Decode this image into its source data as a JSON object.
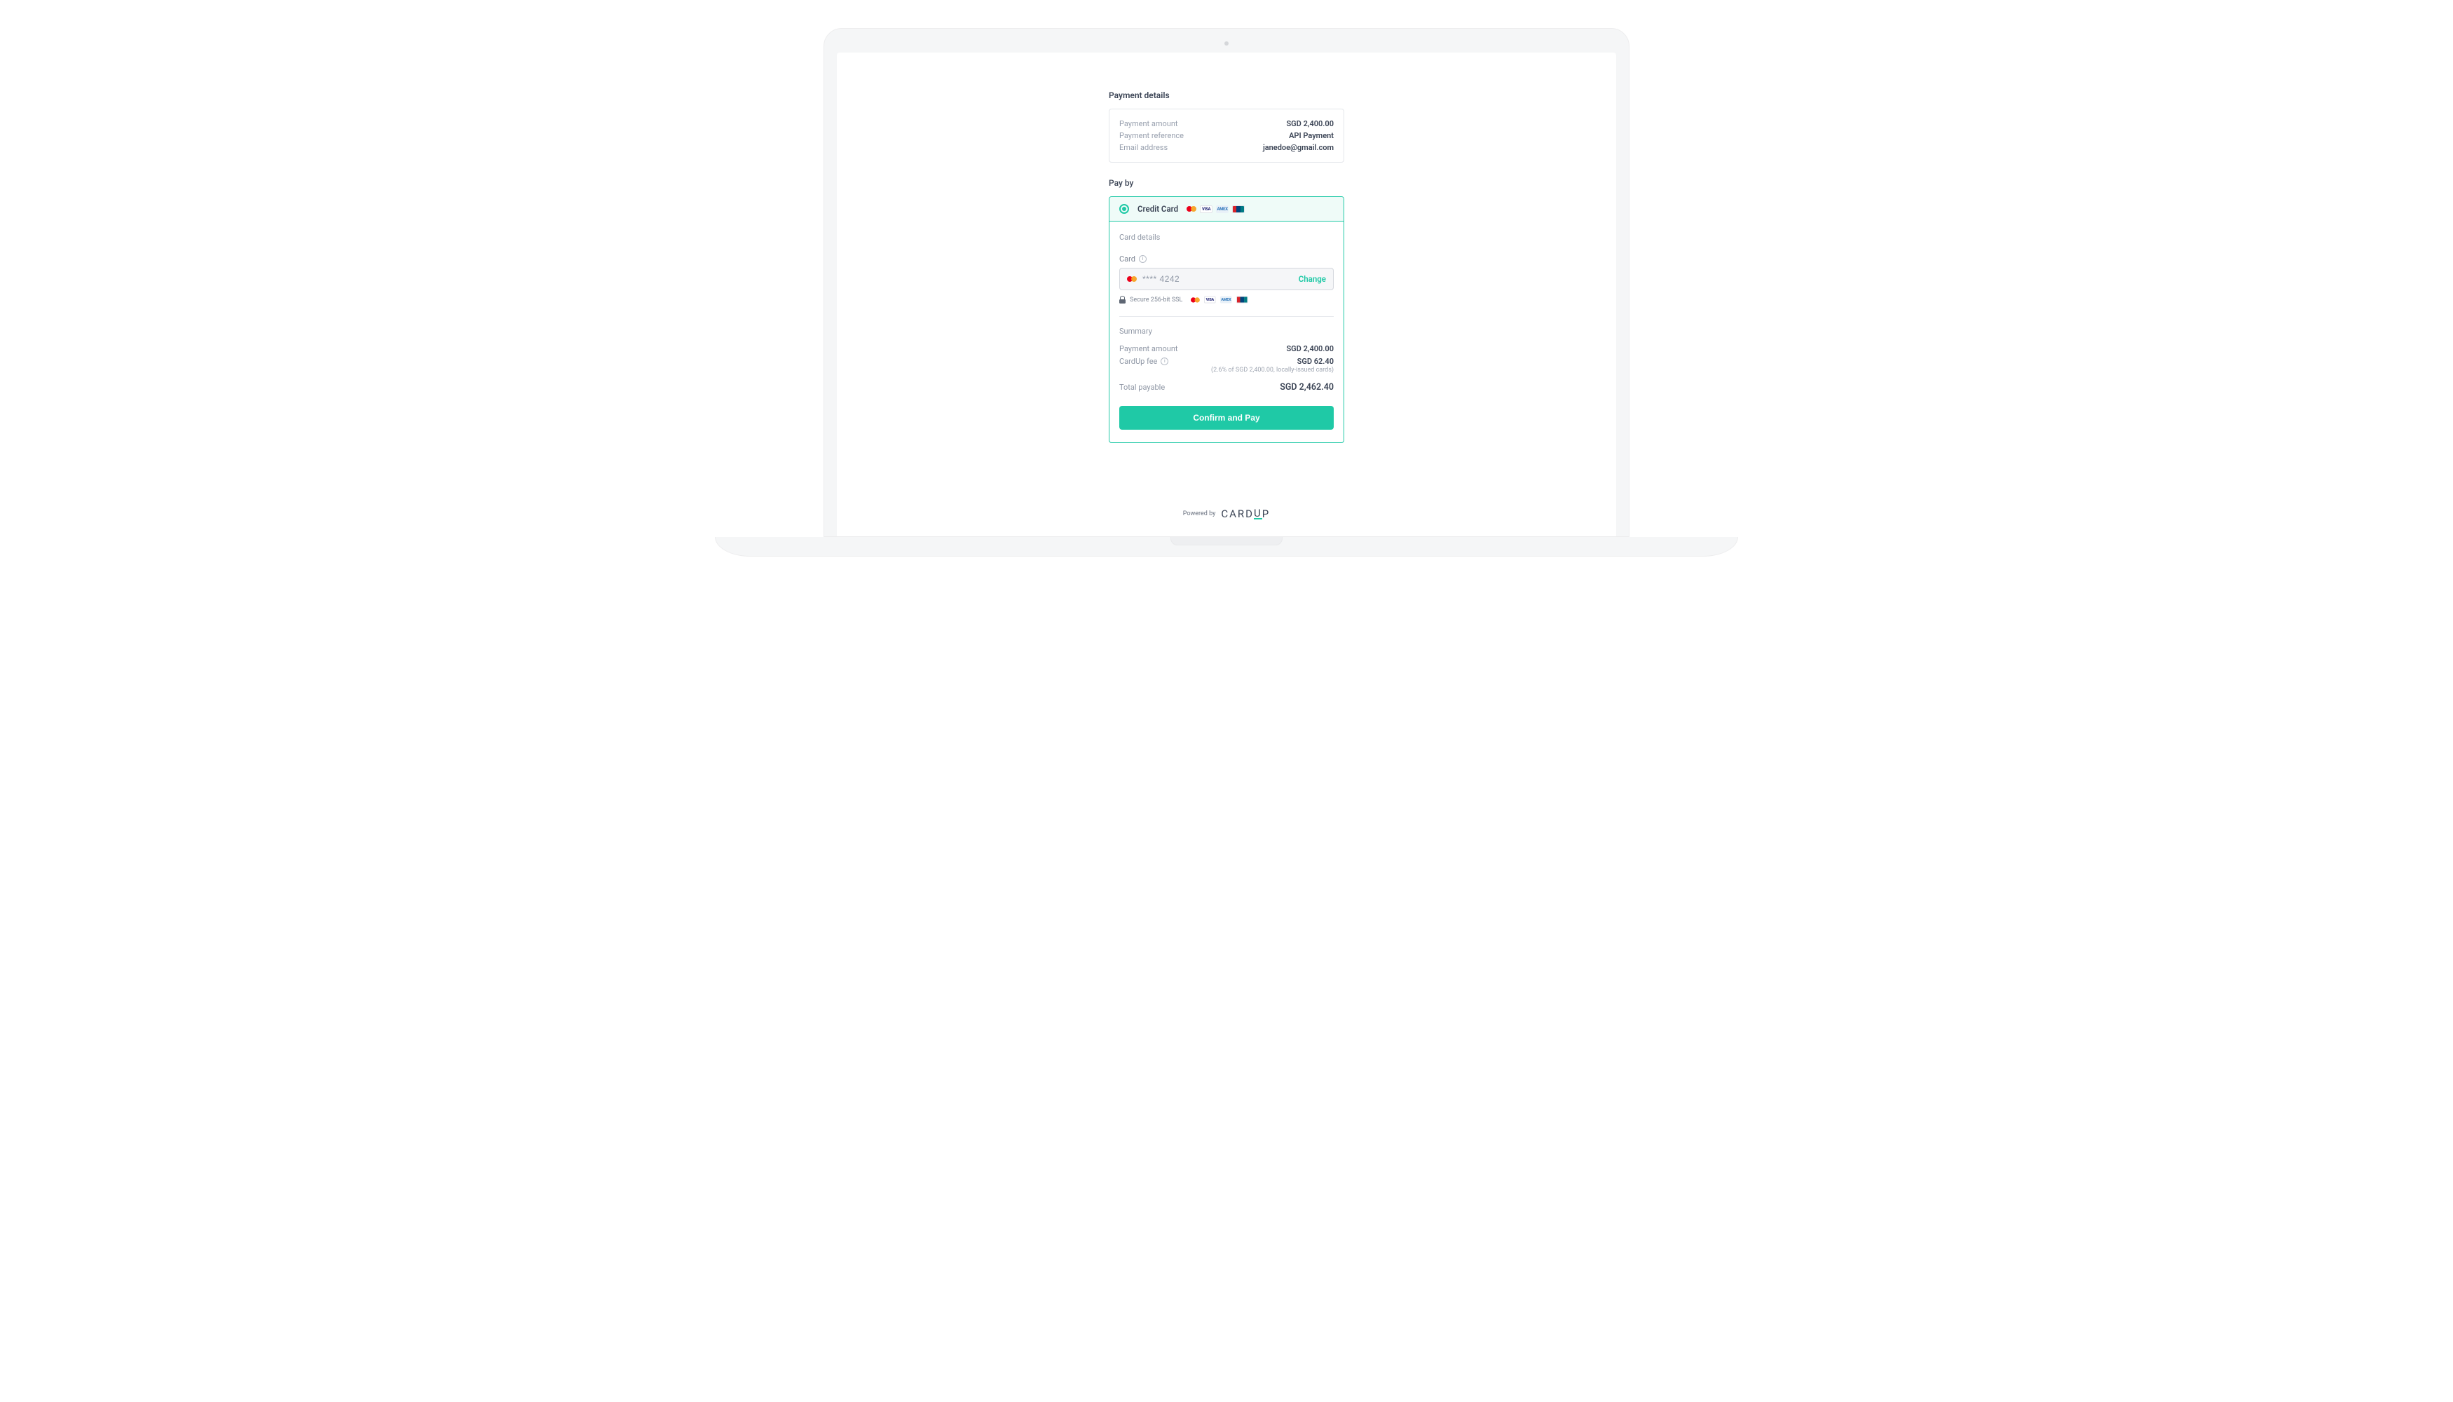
{
  "sections": {
    "payment_details_title": "Payment details",
    "pay_by_title": "Pay by"
  },
  "payment_details": {
    "amount_label": "Payment amount",
    "amount_value": "SGD 2,400.00",
    "reference_label": "Payment reference",
    "reference_value": "API Payment",
    "email_label": "Email address",
    "email_value": "janedoe@gmail.com"
  },
  "pay_by": {
    "option_label": "Credit Card",
    "card_details_title": "Card details",
    "card_field_label": "Card",
    "card_masked_value": "**** 4242",
    "change_label": "Change",
    "ssl_text": "Secure 256-bit SSL"
  },
  "summary": {
    "title": "Summary",
    "amount_label": "Payment amount",
    "amount_value": "SGD 2,400.00",
    "fee_label": "CardUp fee",
    "fee_value": "SGD 62.40",
    "fee_note": "(2.6% of SGD 2,400.00, locally-issued cards)",
    "total_label": "Total payable",
    "total_value": "SGD 2,462.40",
    "confirm_button": "Confirm and Pay"
  },
  "footer": {
    "powered_by": "Powered by",
    "brand_pre": "CARD",
    "brand_accent": "U",
    "brand_post": "P"
  },
  "brands": {
    "visa": "VISA",
    "amex": "AMEX"
  }
}
